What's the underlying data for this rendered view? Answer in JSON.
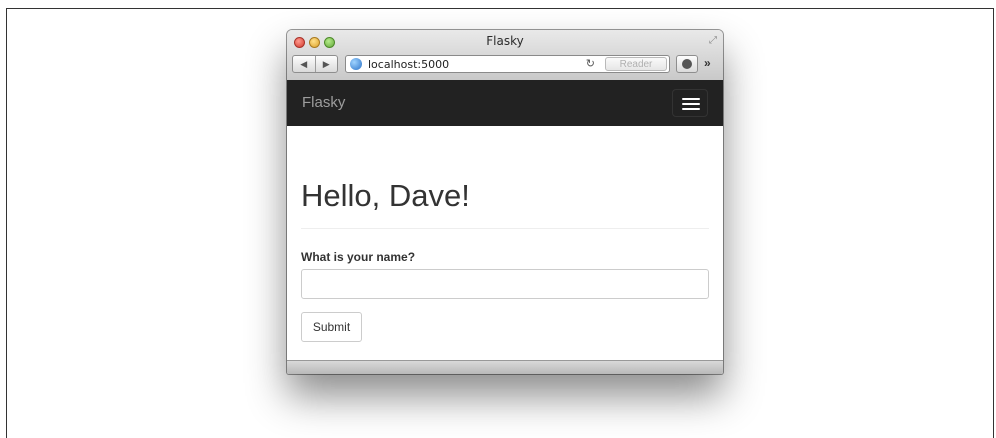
{
  "window": {
    "title": "Flasky",
    "resize_glyph": "⤢"
  },
  "toolbar": {
    "back_glyph": "◀",
    "forward_glyph": "▶",
    "url": "localhost:5000",
    "reload_glyph": "↻",
    "reader_label": "Reader",
    "more_glyph": "»"
  },
  "navbar": {
    "brand": "Flasky"
  },
  "page": {
    "heading": "Hello, Dave!",
    "form_label": "What is your name?",
    "name_value": "",
    "submit_label": "Submit"
  },
  "icons": {
    "back": "back-arrow-icon",
    "forward": "forward-arrow-icon",
    "globe": "globe-icon",
    "reload": "reload-icon",
    "download": "download-icon",
    "menu": "hamburger-menu-icon"
  },
  "colors": {
    "navbar_bg": "#222222",
    "brand_text": "#9d9d9d",
    "heading_text": "#333333"
  }
}
